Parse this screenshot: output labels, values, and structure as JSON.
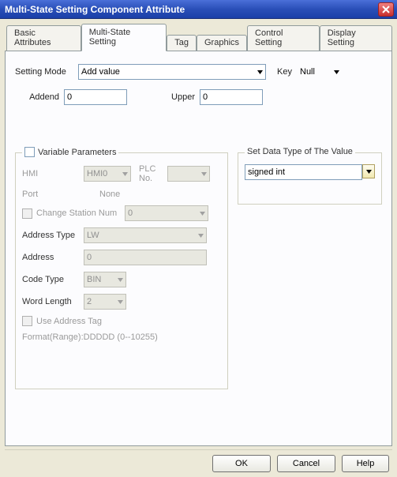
{
  "window": {
    "title": "Multi-State Setting Component Attribute"
  },
  "tabs": [
    {
      "label": "Basic Attributes"
    },
    {
      "label": "Multi-State Setting"
    },
    {
      "label": "Tag"
    },
    {
      "label": "Graphics"
    },
    {
      "label": "Control Setting"
    },
    {
      "label": "Display Setting"
    }
  ],
  "setting": {
    "mode_label": "Setting Mode",
    "mode_value": "Add value",
    "key_label": "Key",
    "key_value": "Null",
    "addend_label": "Addend",
    "addend_value": "0",
    "upper_label": "Upper",
    "upper_value": "0"
  },
  "varparams": {
    "legend": "Variable Parameters",
    "hmi_label": "HMI",
    "hmi_value": "HMI0",
    "plcno_label": "PLC No.",
    "plcno_value": "",
    "port_label": "Port",
    "port_value": "None",
    "change_station_label": "Change Station Num",
    "change_station_value": "0",
    "address_type_label": "Address Type",
    "address_type_value": "LW",
    "address_label": "Address",
    "address_value": "0",
    "code_type_label": "Code Type",
    "code_type_value": "BIN",
    "word_length_label": "Word Length",
    "word_length_value": "2",
    "use_tag_label": "Use Address Tag",
    "format_label": "Format(Range):DDDDD (0--10255)"
  },
  "datatype": {
    "legend": "Set Data Type of The Value",
    "value": "signed int"
  },
  "buttons": {
    "ok": "OK",
    "cancel": "Cancel",
    "help": "Help"
  }
}
